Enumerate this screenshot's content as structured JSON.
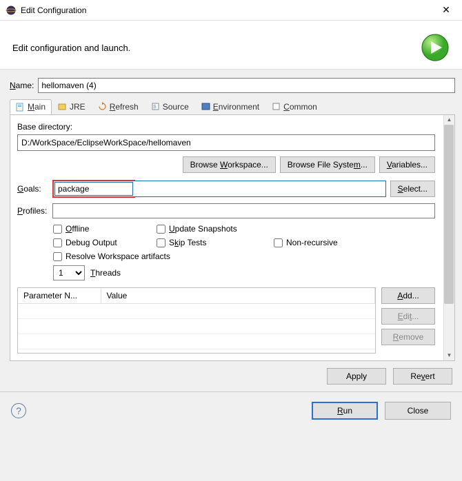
{
  "titlebar": {
    "title": "Edit Configuration"
  },
  "header": {
    "subtitle": "Edit configuration and launch."
  },
  "name": {
    "label": "Name:",
    "value": "hellomaven (4)"
  },
  "tabs": {
    "main": "Main",
    "jre": "JRE",
    "refresh": "Refresh",
    "source": "Source",
    "environment": "Environment",
    "common": "Common"
  },
  "main_tab": {
    "base_dir_label": "Base directory:",
    "base_dir_value": "D:/WorkSpace/EclipseWorkSpace/hellomaven",
    "browse_workspace": "Browse Workspace...",
    "browse_filesystem": "Browse File System...",
    "variables": "Variables...",
    "goals_label": "Goals:",
    "goals_value": "package",
    "select": "Select...",
    "profiles_label": "Profiles:",
    "profiles_value": "",
    "checks": {
      "offline": "Offline",
      "update_snapshots": "Update Snapshots",
      "debug_output": "Debug Output",
      "skip_tests": "Skip Tests",
      "non_recursive": "Non-recursive",
      "resolve_workspace": "Resolve Workspace artifacts"
    },
    "threads_label": "Threads",
    "threads_value": "1",
    "param_table": {
      "col_name": "Parameter N...",
      "col_value": "Value"
    },
    "param_buttons": {
      "add": "Add...",
      "edit": "Edit...",
      "remove": "Remove"
    }
  },
  "apply_row": {
    "apply": "Apply",
    "revert": "Revert"
  },
  "footer": {
    "run": "Run",
    "close": "Close"
  }
}
